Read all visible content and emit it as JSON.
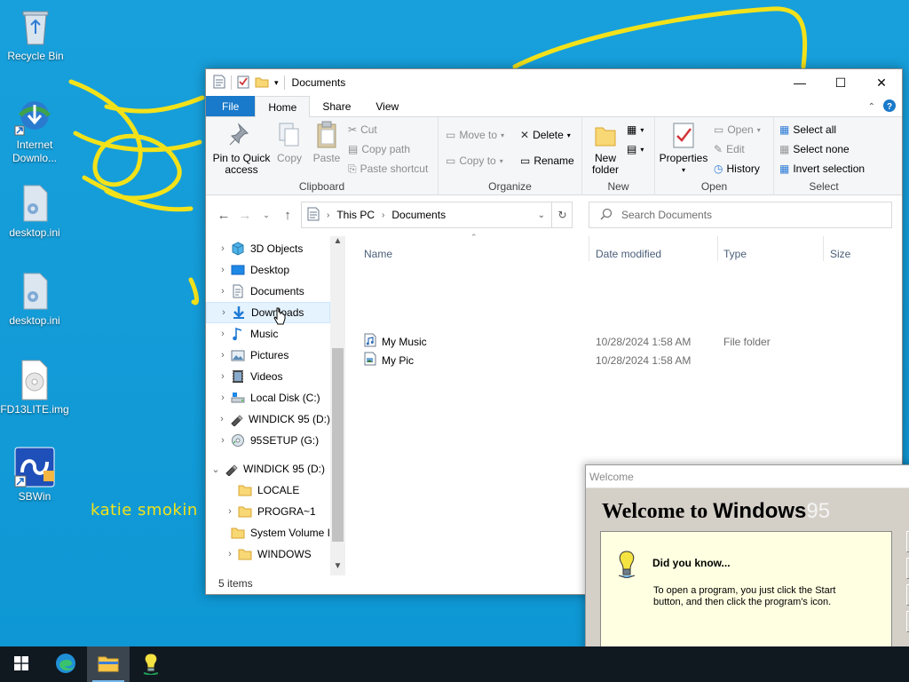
{
  "desktop": {
    "icons": [
      {
        "label": "Recycle Bin",
        "icon": "recycle-bin-icon"
      },
      {
        "label": "Internet Downlo...",
        "icon": "idm-icon"
      },
      {
        "label": "desktop.ini",
        "icon": "ini-file-icon"
      },
      {
        "label": "desktop.ini",
        "icon": "ini-file-icon"
      },
      {
        "label": "FD13LITE.img",
        "icon": "disk-image-icon"
      },
      {
        "label": "SBWin",
        "icon": "sbwin-icon"
      }
    ],
    "scribble_text": "katie smokin",
    "scribble_color": "#f3e21a",
    "background_color": "#0f9bd7"
  },
  "explorer": {
    "title": "Documents",
    "controls": {
      "minimize": "—",
      "maximize": "☐",
      "close": "✕"
    },
    "tabs": [
      "File",
      "Home",
      "Share",
      "View"
    ],
    "active_tab": "Home",
    "ribbon": {
      "clipboard": {
        "label": "Clipboard",
        "pin": "Pin to Quick access",
        "copy": "Copy",
        "paste": "Paste",
        "cut": "Cut",
        "copy_path": "Copy path",
        "paste_shortcut": "Paste shortcut"
      },
      "organize": {
        "label": "Organize",
        "move_to": "Move to",
        "copy_to": "Copy to",
        "delete": "Delete",
        "rename": "Rename"
      },
      "new": {
        "label": "New",
        "new_folder": "New folder"
      },
      "open": {
        "label": "Open",
        "properties": "Properties",
        "open": "Open",
        "edit": "Edit",
        "history": "History"
      },
      "select": {
        "label": "Select",
        "select_all": "Select all",
        "select_none": "Select none",
        "invert": "Invert selection"
      }
    },
    "address": {
      "crumbs": [
        "This PC",
        "Documents"
      ],
      "search_placeholder": "Search Documents"
    },
    "nav_items": [
      {
        "label": "3D Objects",
        "icon": "3d-objects-icon",
        "level": 1,
        "chev": "›"
      },
      {
        "label": "Desktop",
        "icon": "desktop-folder-icon",
        "level": 1,
        "chev": "›"
      },
      {
        "label": "Documents",
        "icon": "documents-icon",
        "level": 1,
        "chev": "›"
      },
      {
        "label": "Downloads",
        "icon": "downloads-icon",
        "level": 1,
        "chev": "›",
        "selected": true
      },
      {
        "label": "Music",
        "icon": "music-icon",
        "level": 1,
        "chev": "›"
      },
      {
        "label": "Pictures",
        "icon": "pictures-icon",
        "level": 1,
        "chev": "›"
      },
      {
        "label": "Videos",
        "icon": "videos-icon",
        "level": 1,
        "chev": "›"
      },
      {
        "label": "Local Disk (C:)",
        "icon": "local-disk-icon",
        "level": 1,
        "chev": "›"
      },
      {
        "label": "WINDICK 95 (D:)",
        "icon": "usb-drive-icon",
        "level": 1,
        "chev": "›"
      },
      {
        "label": "95SETUP (G:)",
        "icon": "cd-drive-icon",
        "level": 1,
        "chev": "›"
      },
      {
        "label": "WINDICK 95 (D:)",
        "icon": "usb-drive-icon",
        "level": 0,
        "chev": "⌄"
      },
      {
        "label": "LOCALE",
        "icon": "folder-icon",
        "level": 2,
        "chev": ""
      },
      {
        "label": "PROGRA~1",
        "icon": "folder-icon",
        "level": 2,
        "chev": "›"
      },
      {
        "label": "System Volume I",
        "icon": "folder-icon",
        "level": 2,
        "chev": ""
      },
      {
        "label": "WINDOWS",
        "icon": "folder-icon",
        "level": 2,
        "chev": "›"
      }
    ],
    "columns": [
      "Name",
      "Date modified",
      "Type",
      "Size"
    ],
    "files": [
      {
        "name": "My Music",
        "date": "10/28/2024 1:58 AM",
        "type": "File folder"
      },
      {
        "name": "My Pic",
        "date": "10/28/2024 1:58 AM",
        "type": ""
      }
    ],
    "status": "5 items"
  },
  "welcome": {
    "title": "Welcome",
    "heading_prefix": "Welcome to ",
    "heading_brand": "Windows",
    "heading_version": "95",
    "did_you_know": "Did you know...",
    "tip": "To open a program, you just click the Start button, and then click the program's icon."
  },
  "taskbar": {
    "items": [
      "start-icon",
      "edge-icon",
      "file-explorer-icon",
      "idm-taskbar-icon"
    ],
    "active": "file-explorer-icon"
  }
}
